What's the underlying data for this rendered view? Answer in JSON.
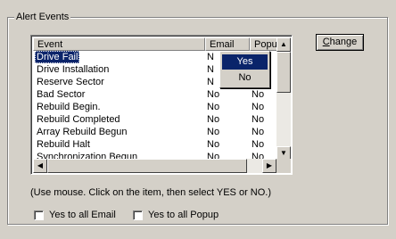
{
  "group_title": "Alert Events",
  "columns": [
    "Event",
    "Email",
    "Popup"
  ],
  "rows": [
    {
      "event": "Drive Fail",
      "email": "N",
      "popup": ""
    },
    {
      "event": "Drive Installation",
      "email": "N",
      "popup": ""
    },
    {
      "event": "Reserve Sector",
      "email": "N",
      "popup": ""
    },
    {
      "event": "Bad Sector",
      "email": "No",
      "popup": "No"
    },
    {
      "event": "Rebuild Begin.",
      "email": "No",
      "popup": "No"
    },
    {
      "event": "Rebuild Completed",
      "email": "No",
      "popup": "No"
    },
    {
      "event": "Array Rebuild Begun",
      "email": "No",
      "popup": "No"
    },
    {
      "event": "Rebuild Halt",
      "email": "No",
      "popup": "No"
    },
    {
      "event": "Synchronization Begun",
      "email": "No",
      "popup": "No"
    }
  ],
  "selected_row": 0,
  "context_menu": {
    "items": [
      "Yes",
      "No"
    ],
    "highlighted": "Yes"
  },
  "change_button": {
    "underlined": "C",
    "rest": "hange"
  },
  "hint": "(Use mouse. Click on the item, then select YES or NO.)",
  "checkboxes": {
    "email": "Yes to all Email",
    "popup": "Yes to all Popup"
  },
  "icons": {
    "scroll_up": "scroll-up-arrow-icon",
    "scroll_down": "scroll-down-arrow-icon",
    "scroll_left": "scroll-left-arrow-icon",
    "scroll_right": "scroll-right-arrow-icon"
  },
  "colors": {
    "face": "#d4d0c8",
    "selection": "#0a246a"
  }
}
